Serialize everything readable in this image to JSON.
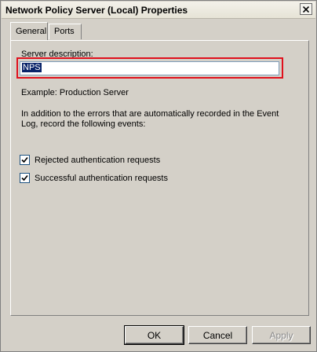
{
  "window": {
    "title": "Network Policy Server (Local) Properties"
  },
  "tabs": [
    {
      "label": "General",
      "active": true
    },
    {
      "label": "Ports",
      "active": false
    }
  ],
  "general": {
    "server_description_label": "Server description:",
    "server_description_value": "NPS",
    "example_text": "Example: Production Server",
    "info_line1": "In addition to the errors that are automatically recorded in the Event",
    "info_line2": "Log, record the following events:",
    "checkboxes": [
      {
        "label": "Rejected authentication requests",
        "checked": true
      },
      {
        "label": "Successful authentication requests",
        "checked": true
      }
    ]
  },
  "buttons": {
    "ok": "OK",
    "cancel": "Cancel",
    "apply": "Apply"
  },
  "colors": {
    "highlight_border": "#e0101c",
    "selection": "#0a246a",
    "dialog_bg": "#d4d0c8"
  }
}
